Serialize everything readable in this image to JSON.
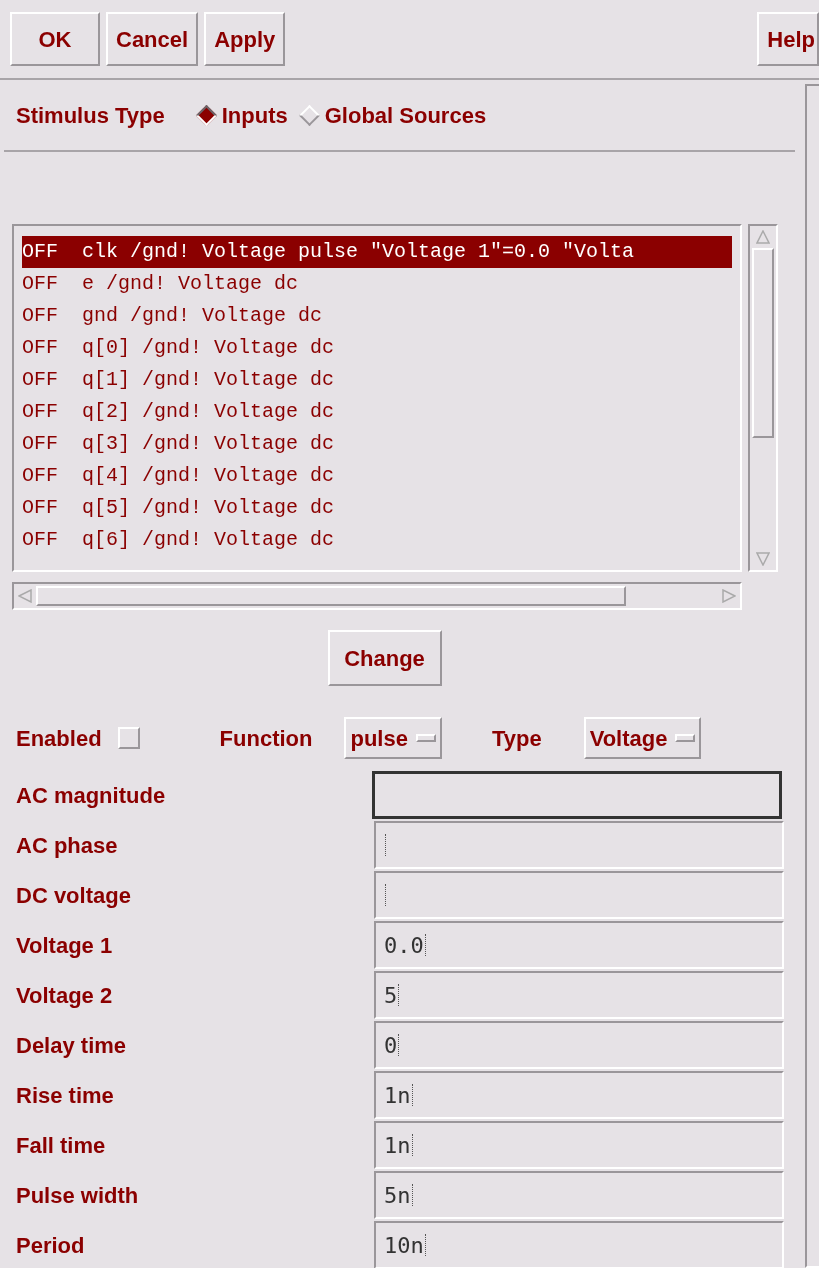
{
  "toolbar": {
    "buttons": [
      "OK",
      "Cancel",
      "Apply"
    ],
    "help": "Help"
  },
  "stimulus_type": {
    "label": "Stimulus Type",
    "options": [
      {
        "label": "Inputs",
        "selected": true
      },
      {
        "label": "Global Sources",
        "selected": false
      }
    ]
  },
  "stimulus_list": {
    "rows": [
      {
        "status": "OFF",
        "text": "clk /gnd! Voltage pulse \"Voltage 1\"=0.0 \"Volta",
        "selected": true
      },
      {
        "status": "OFF",
        "text": "e /gnd! Voltage dc",
        "selected": false
      },
      {
        "status": "OFF",
        "text": "gnd /gnd! Voltage dc",
        "selected": false
      },
      {
        "status": "OFF",
        "text": "q[0] /gnd! Voltage dc",
        "selected": false
      },
      {
        "status": "OFF",
        "text": "q[1] /gnd! Voltage dc",
        "selected": false
      },
      {
        "status": "OFF",
        "text": "q[2] /gnd! Voltage dc",
        "selected": false
      },
      {
        "status": "OFF",
        "text": "q[3] /gnd! Voltage dc",
        "selected": false
      },
      {
        "status": "OFF",
        "text": "q[4] /gnd! Voltage dc",
        "selected": false
      },
      {
        "status": "OFF",
        "text": "q[5] /gnd! Voltage dc",
        "selected": false
      },
      {
        "status": "OFF",
        "text": "q[6] /gnd! Voltage dc",
        "selected": false
      }
    ]
  },
  "change_button": "Change",
  "settings": {
    "enabled": {
      "label": "Enabled",
      "checked": false
    },
    "function": {
      "label": "Function",
      "value": "pulse"
    },
    "type": {
      "label": "Type",
      "value": "Voltage"
    }
  },
  "fields": [
    {
      "label": "AC magnitude",
      "focused": true
    },
    {
      "label": "AC phase",
      "focused": false
    },
    {
      "label": "DC voltage",
      "focused": false
    },
    {
      "label": "Voltage 1",
      "value": "0.0",
      "focused": false
    },
    {
      "label": "Voltage 2",
      "value": "5",
      "focused": false
    },
    {
      "label": "Delay time",
      "value": "0",
      "focused": false
    },
    {
      "label": "Rise time",
      "value": "1n",
      "focused": false
    },
    {
      "label": "Fall time",
      "value": "1n",
      "focused": false
    },
    {
      "label": "Pulse width",
      "value": "5n",
      "focused": false
    },
    {
      "label": "Period",
      "value": "10n",
      "focused": false
    }
  ]
}
